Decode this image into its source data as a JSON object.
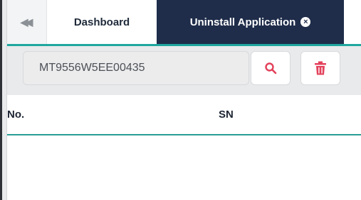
{
  "tabs": {
    "collapse_icon": "double-chevron-left-icon",
    "dashboard_label": "Dashboard",
    "active_label": "Uninstall Application",
    "active_close_icon": "close-circle-icon",
    "active_close_glyph": "×"
  },
  "toolbar": {
    "search_value": "MT9556W5EE00435",
    "search_button_icon": "search-icon",
    "delete_button_icon": "trash-icon"
  },
  "table": {
    "columns": [
      "No.",
      "SN"
    ],
    "rows": []
  },
  "colors": {
    "active_tab_bg": "#1f2d4a",
    "accent_teal": "#1ea79e",
    "search_icon": "#e3415b",
    "delete_icon": "#e3415b"
  }
}
